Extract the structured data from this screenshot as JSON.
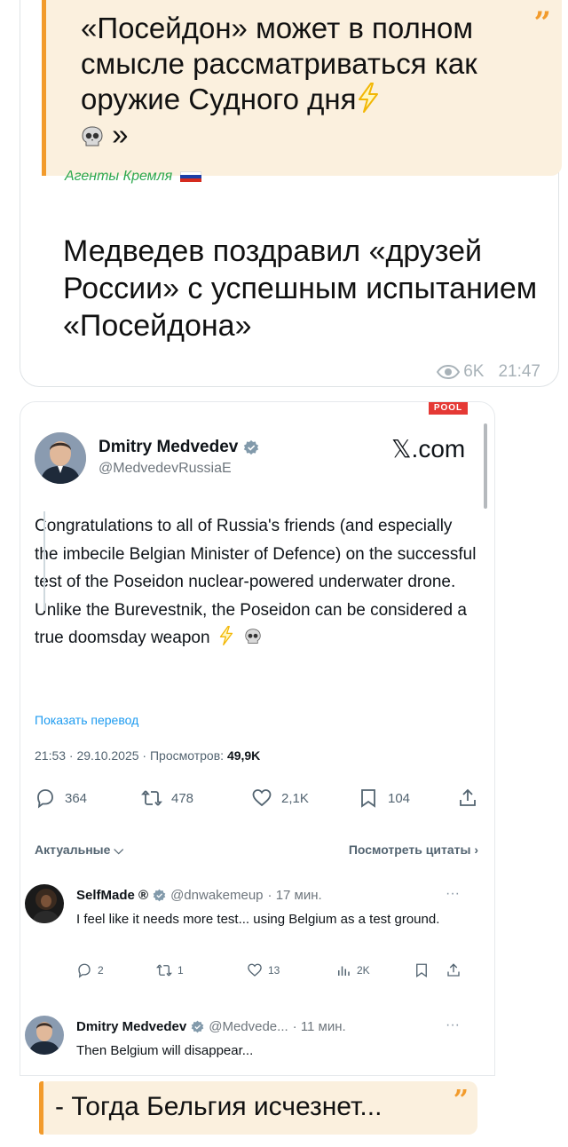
{
  "telegram_post": {
    "quote_text": "«Посейдон» может в полном смысле рассматриваться как оружие Судного дня",
    "quote_end": "»",
    "quote_mark": "”",
    "source": "Агенты Кремля",
    "headline": "Медведев поздравил «друзей России» с успешным испытанием «Посейдона»",
    "views": "6K",
    "time": "21:47"
  },
  "tweet": {
    "badge": "POOL",
    "author_name": "Dmitry Medvedev",
    "author_handle": "@MedvedevRussiaE",
    "site": "𝕏.com",
    "text": "Congratulations to all of Russia's friends (and especially the imbecile Belgian Minister of Defence) on the successful test of the Poseidon nuclear-powered underwater drone. Unlike the Burevestnik, the Poseidon can be considered a true doomsday weapon",
    "translate_link": "Показать перевод",
    "timestamp": "21:53 · 29.10.2025 · Просмотров:",
    "views": "49,9K",
    "replies": "364",
    "retweets": "478",
    "likes": "2,1K",
    "bookmarks": "104",
    "sort_label": "Актуальные",
    "quotes_link": "Посмотреть цитаты"
  },
  "replies": [
    {
      "name": "SelfMade ®",
      "handle": "@dnwakemeup",
      "time": "· 17 мин.",
      "text": "I feel like it needs more test... using Belgium as a test ground.",
      "replies": "2",
      "retweets": "1",
      "likes": "13",
      "views": "2K"
    },
    {
      "name": "Dmitry Medvedev",
      "handle": "@Medvede...",
      "time": "· 11 мин.",
      "text": "Then Belgium will disappear..."
    }
  ],
  "bottom_quote": {
    "text": "- Тогда Бельгия исчезнет...",
    "mark": "”"
  },
  "colors": {
    "quote_bar": "#f29b2c",
    "quote_bg": "#fbf0de",
    "source_green": "#2ea84e",
    "twitter_blue": "#1d9bf0"
  }
}
